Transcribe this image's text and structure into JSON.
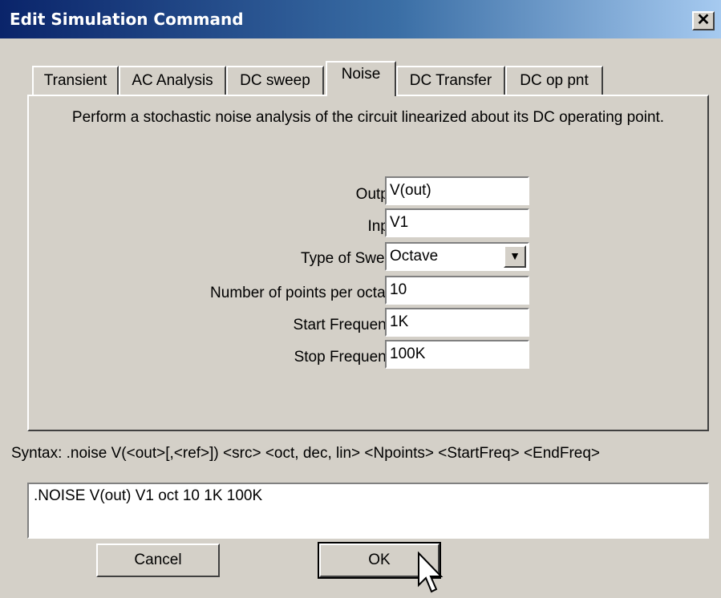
{
  "window": {
    "title": "Edit Simulation Command",
    "close_glyph": "✕"
  },
  "tabs": [
    {
      "label": "Transient"
    },
    {
      "label": "AC Analysis"
    },
    {
      "label": "DC sweep"
    },
    {
      "label": "Noise",
      "active": true
    },
    {
      "label": "DC Transfer"
    },
    {
      "label": "DC op pnt"
    }
  ],
  "panel": {
    "description": "Perform a stochastic noise analysis of the circuit linearized about its DC operating point.",
    "output_label": "Output:",
    "output_value": "V(out)",
    "input_label": "Input:",
    "input_value": "V1",
    "sweep_label": "Type of Sweep:",
    "sweep_value": "Octave",
    "points_label": "Number of points per octave:",
    "points_value": "10",
    "start_label": "Start Frequency:",
    "start_value": "1K",
    "stop_label": "Stop Frequency:",
    "stop_value": "100K"
  },
  "syntax": "Syntax:  .noise V(<out>[,<ref>]) <src> <oct, dec, lin> <Npoints> <StartFreq> <EndFreq>",
  "command_text": ".NOISE V(out) V1 oct 10 1K 100K",
  "buttons": {
    "cancel": "Cancel",
    "ok": "OK"
  },
  "icons": {
    "dropdown": "chevron-down-icon",
    "cursor": "mouse-cursor-icon"
  }
}
